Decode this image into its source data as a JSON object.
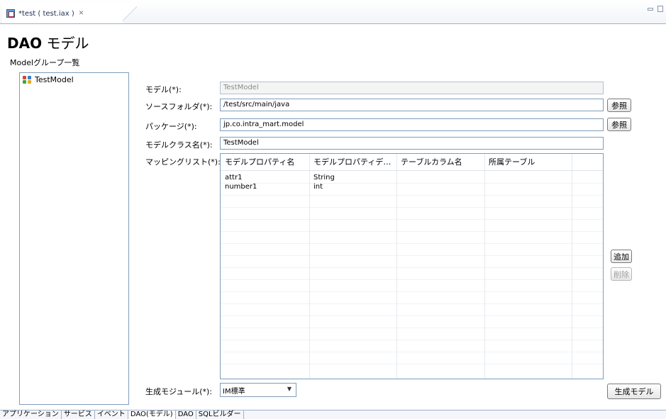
{
  "editor_tab": {
    "title": "*test ( test.iax )",
    "close": "✕"
  },
  "page": {
    "title_bold": "DAO",
    "title_rest": " モデル"
  },
  "group_list": {
    "label": "Modelグループ一覧",
    "items": [
      {
        "label": "TestModel"
      }
    ]
  },
  "form": {
    "model": {
      "label": "モデル(*):",
      "value": "TestModel"
    },
    "source_folder": {
      "label": "ソースフォルダ(*):",
      "value": "/test/src/main/java",
      "button": "参照"
    },
    "package": {
      "label": "パッケージ(*):",
      "value": "jp.co.intra_mart.model",
      "button": "参照"
    },
    "model_class": {
      "label": "モデルクラス名(*):",
      "value": "TestModel"
    },
    "mapping": {
      "label": "マッピングリスト(*):"
    },
    "module": {
      "label": "生成モジュール(*):",
      "value": "IM標準"
    }
  },
  "table": {
    "columns": [
      "モデルプロパティ名",
      "モデルプロパティデ…",
      "テーブルカラム名",
      "所属テーブル"
    ],
    "rows": [
      [
        "attr1",
        "String",
        "",
        ""
      ],
      [
        "number1",
        "int",
        "",
        ""
      ]
    ]
  },
  "buttons": {
    "add": "追加",
    "delete": "削除",
    "generate": "生成モデル"
  },
  "bottom_tabs": [
    "アプリケーション",
    "サービス",
    "イベント",
    "DAO(モデル)",
    "DAO",
    "SQLビルダー"
  ]
}
